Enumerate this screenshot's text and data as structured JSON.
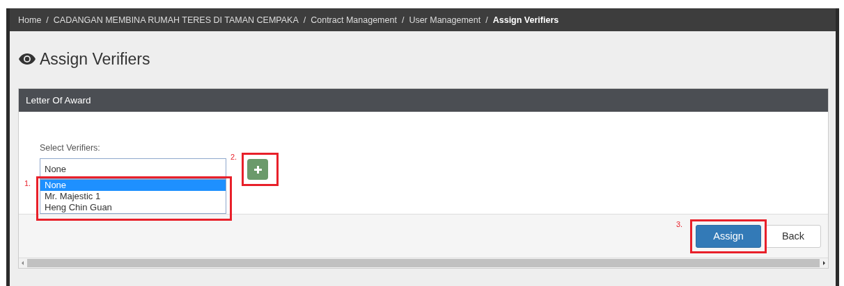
{
  "breadcrumb": [
    {
      "label": "Home",
      "current": false
    },
    {
      "label": "CADANGAN MEMBINA RUMAH TERES DI TAMAN CEMPAKA",
      "current": false
    },
    {
      "label": "Contract Management",
      "current": false
    },
    {
      "label": "User Management",
      "current": false
    },
    {
      "label": "Assign Verifiers",
      "current": true
    }
  ],
  "breadcrumb_separator": "/",
  "page_title": "Assign Verifiers",
  "panel": {
    "title": "Letter Of Award",
    "field": {
      "label": "Select Verifiers:",
      "value": "None",
      "expanded": true,
      "options": [
        {
          "label": "None",
          "selected": true
        },
        {
          "label": "Mr. Majestic 1",
          "selected": false
        },
        {
          "label": "Heng Chin Guan",
          "selected": false
        }
      ]
    },
    "buttons": [
      {
        "label": "Assign",
        "kind": "primary"
      },
      {
        "label": "Back",
        "kind": "default"
      }
    ]
  },
  "annotations": [
    "1.",
    "2.",
    "3."
  ]
}
